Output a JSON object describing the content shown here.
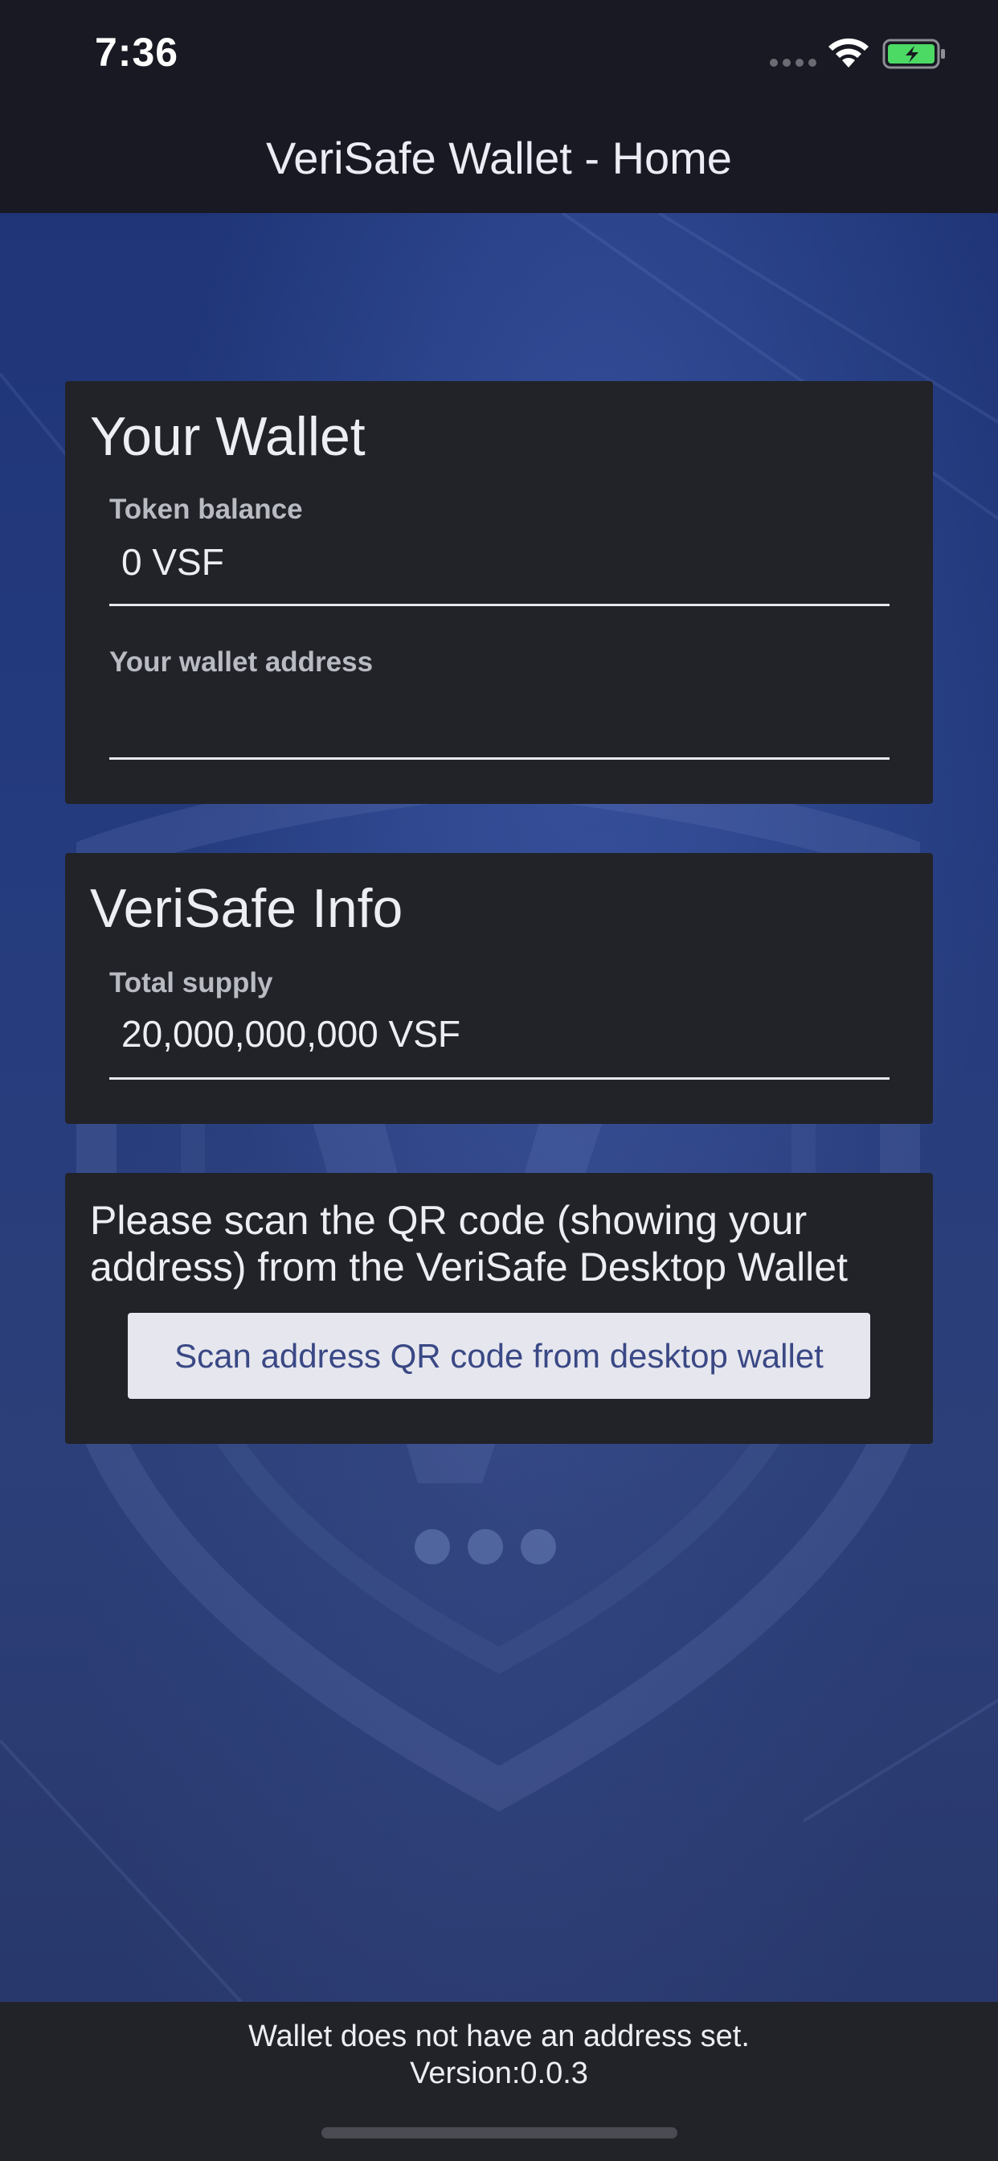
{
  "status_bar": {
    "time": "7:36"
  },
  "header": {
    "title": "VeriSafe Wallet - Home"
  },
  "wallet_card": {
    "title": "Your Wallet",
    "token_balance_label": "Token balance",
    "token_balance_value": "0 VSF",
    "address_label": "Your wallet address",
    "address_value": ""
  },
  "info_card": {
    "title": "VeriSafe Info",
    "total_supply_label": "Total supply",
    "total_supply_value": "20,000,000,000 VSF"
  },
  "scan_card": {
    "instruction": "Please scan the QR code (showing your address) from the VeriSafe Desktop Wallet",
    "button_label": "Scan address QR code from desktop wallet"
  },
  "footer": {
    "status_message": "Wallet does not have an address set.",
    "version": "Version:0.0.3"
  },
  "colors": {
    "card_background": "#222329",
    "header_background": "#181922",
    "button_background": "#e6e7ee",
    "button_text": "#3a4885",
    "battery_fill": "#4cd964"
  },
  "icons": [
    "signal-icon",
    "wifi-icon",
    "battery-charging-icon"
  ]
}
